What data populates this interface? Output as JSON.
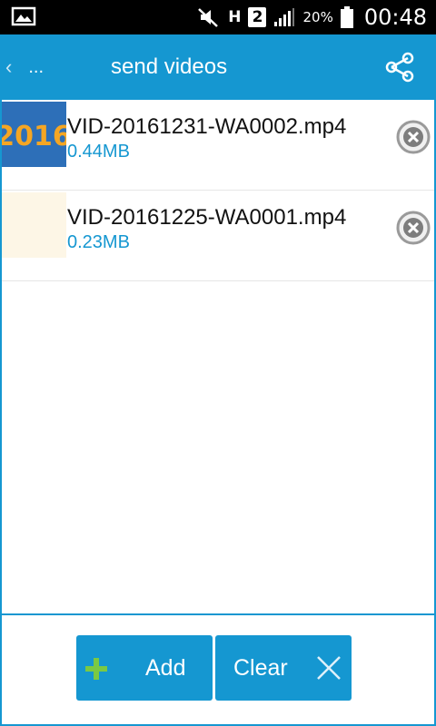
{
  "status_bar": {
    "image_icon": "image-notification-icon",
    "mute_icon": "muted-speaker-icon",
    "network_type": "H",
    "sim_slot": "2",
    "signal_icon": "signal-bars-icon",
    "battery_percent": "20%",
    "battery_icon": "battery-icon",
    "time": "00:48"
  },
  "action_bar": {
    "back_label": "...",
    "title": "send videos",
    "share_icon": "share-icon"
  },
  "videos": [
    {
      "name": "VID-20161231-WA0002.mp4",
      "size": "0.44MB",
      "thumb_text": "2016"
    },
    {
      "name": "VID-20161225-WA0001.mp4",
      "size": "0.23MB"
    }
  ],
  "buttons": {
    "add_label": "Add",
    "clear_label": "Clear"
  },
  "colors": {
    "accent": "#1597d1",
    "add_plus": "#7ac943"
  }
}
